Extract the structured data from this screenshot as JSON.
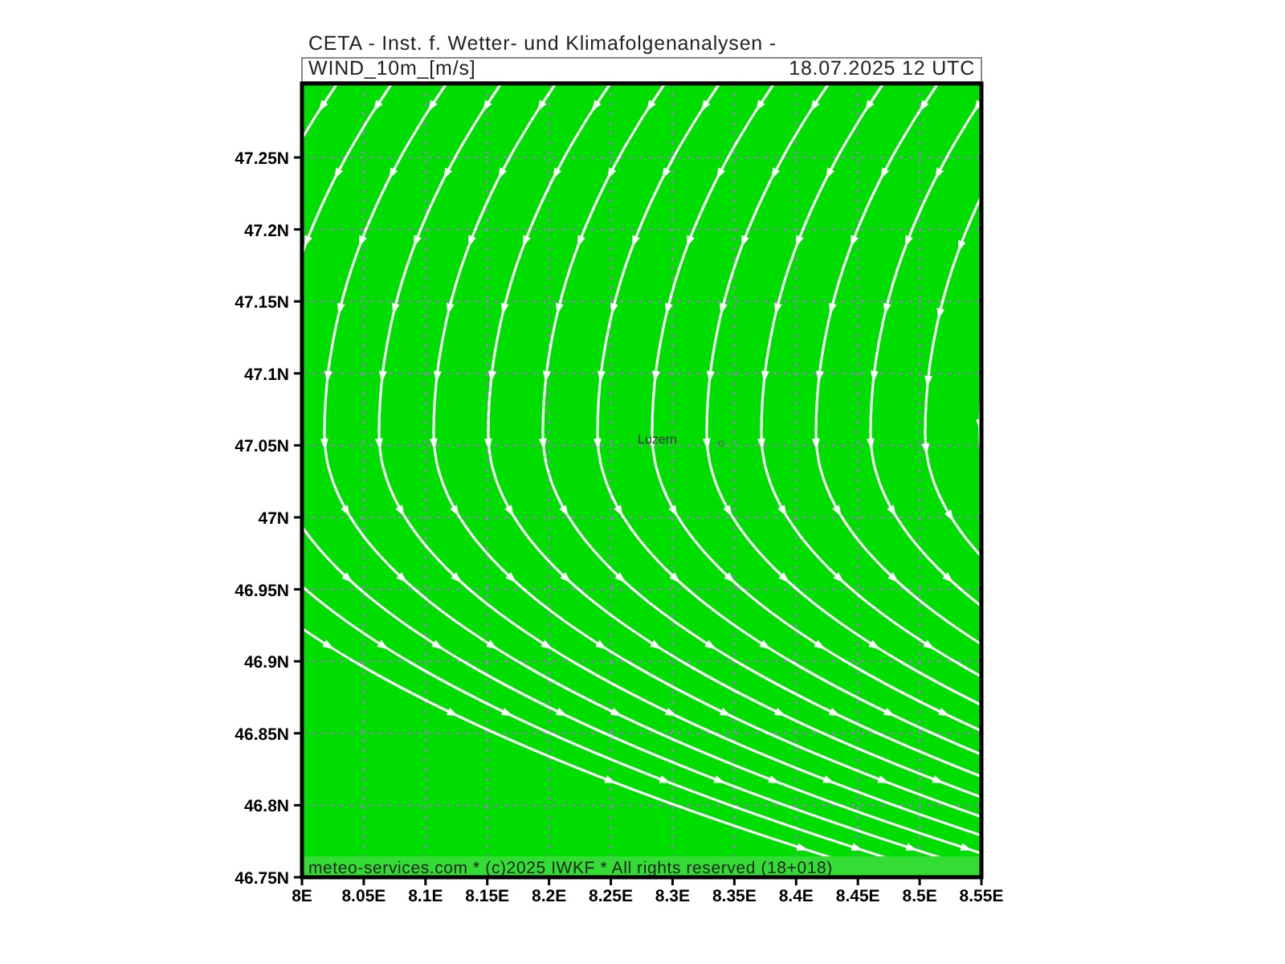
{
  "header": {
    "title": "CETA - Inst. f. Wetter- und Klimafolgenanalysen -",
    "field_label": "WIND_10m_[m/s]",
    "valid_time": "18.07.2025 12 UTC"
  },
  "map": {
    "place_labels": [
      "Luzern"
    ],
    "lat_ticks": [
      "47.25N",
      "47.2N",
      "47.15N",
      "47.1N",
      "47.05N",
      "47N",
      "46.95N",
      "46.9N",
      "46.85N",
      "46.8N",
      "46.75N"
    ],
    "lon_ticks": [
      "8E",
      "8.05E",
      "8.1E",
      "8.15E",
      "8.2E",
      "8.25E",
      "8.3E",
      "8.35E",
      "8.4E",
      "8.45E",
      "8.5E",
      "8.55E"
    ],
    "footer": "meteo-services.com * (c)2025 IWKF * All rights reserved (18+018)"
  }
}
